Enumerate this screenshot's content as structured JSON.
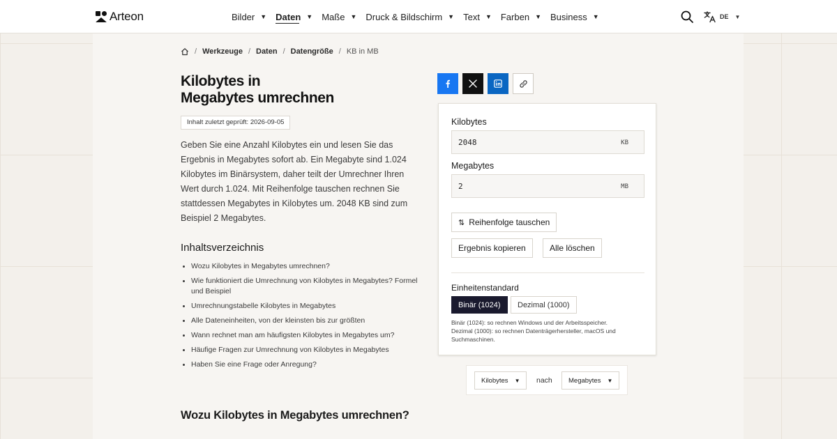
{
  "brand": {
    "name": "Arteon"
  },
  "nav": {
    "items": [
      {
        "label": "Bilder",
        "active": false
      },
      {
        "label": "Daten",
        "active": true
      },
      {
        "label": "Maße",
        "active": false
      },
      {
        "label": "Druck & Bildschirm",
        "active": false
      },
      {
        "label": "Text",
        "active": false
      },
      {
        "label": "Farben",
        "active": false
      },
      {
        "label": "Business",
        "active": false
      }
    ],
    "language": "DE"
  },
  "breadcrumb": {
    "home_icon": "home-icon",
    "items": [
      "Werkzeuge",
      "Daten",
      "Datengröße",
      "KB in MB"
    ]
  },
  "page": {
    "title_line1": "Kilobytes in",
    "title_line2": "Megabytes umrechnen",
    "review_badge": "Inhalt zuletzt geprüft: 2026-09-05",
    "intro": "Geben Sie eine Anzahl Kilobytes ein und lesen Sie das Ergebnis in Megabytes sofort ab. Ein Megabyte sind 1.024 Kilobytes im Binärsystem, daher teilt der Umrechner Ihren Wert durch 1.024. Mit Reihenfolge tauschen rechnen Sie stattdessen Megabytes in Kilobytes um. 2048 KB sind zum Beispiel 2 Megabytes.",
    "toc_heading": "Inhaltsverzeichnis",
    "toc": [
      "Wozu Kilobytes in Megabytes umrechnen?",
      "Wie funktioniert die Umrechnung von Kilobytes in Megabytes? Formel und Beispiel",
      "Umrechnungstabelle Kilobytes in Megabytes",
      "Alle Dateneinheiten, von der kleinsten bis zur größten",
      "Wann rechnet man am häufigsten Kilobytes in Megabytes um?",
      "Häufige Fragen zur Umrechnung von Kilobytes in Megabytes",
      "Haben Sie eine Frage oder Anregung?"
    ],
    "section_heading": "Wozu Kilobytes in Megabytes umrechnen?"
  },
  "share": {
    "facebook_icon": "facebook-icon",
    "x_icon": "x-icon",
    "linkedin_icon": "linkedin-icon",
    "link_icon": "link-icon"
  },
  "converter": {
    "from_label": "Kilobytes",
    "from_value": "2048",
    "from_unit": "KB",
    "to_label": "Megabytes",
    "to_value": "2",
    "to_unit": "MB",
    "swap_label": "Reihenfolge tauschen",
    "copy_label": "Ergebnis kopieren",
    "clear_label": "Alle löschen",
    "standard_label": "Einheitenstandard",
    "standard_binary": "Binär (1024)",
    "standard_decimal": "Dezimal (1000)",
    "standard_selected": "Binär (1024)",
    "note_binary": "Binär (1024): so rechnen Windows und der Arbeitsspeicher.",
    "note_decimal": "Dezimal (1000): so rechnen Datenträgerhersteller, macOS und Suchmaschinen."
  },
  "unit_selector": {
    "from": "Kilobytes",
    "connector": "nach",
    "to": "Megabytes"
  },
  "colors": {
    "accent_dark": "#1a1a2e",
    "facebook": "#1877f2",
    "x": "#111111",
    "linkedin": "#0a66c2"
  }
}
